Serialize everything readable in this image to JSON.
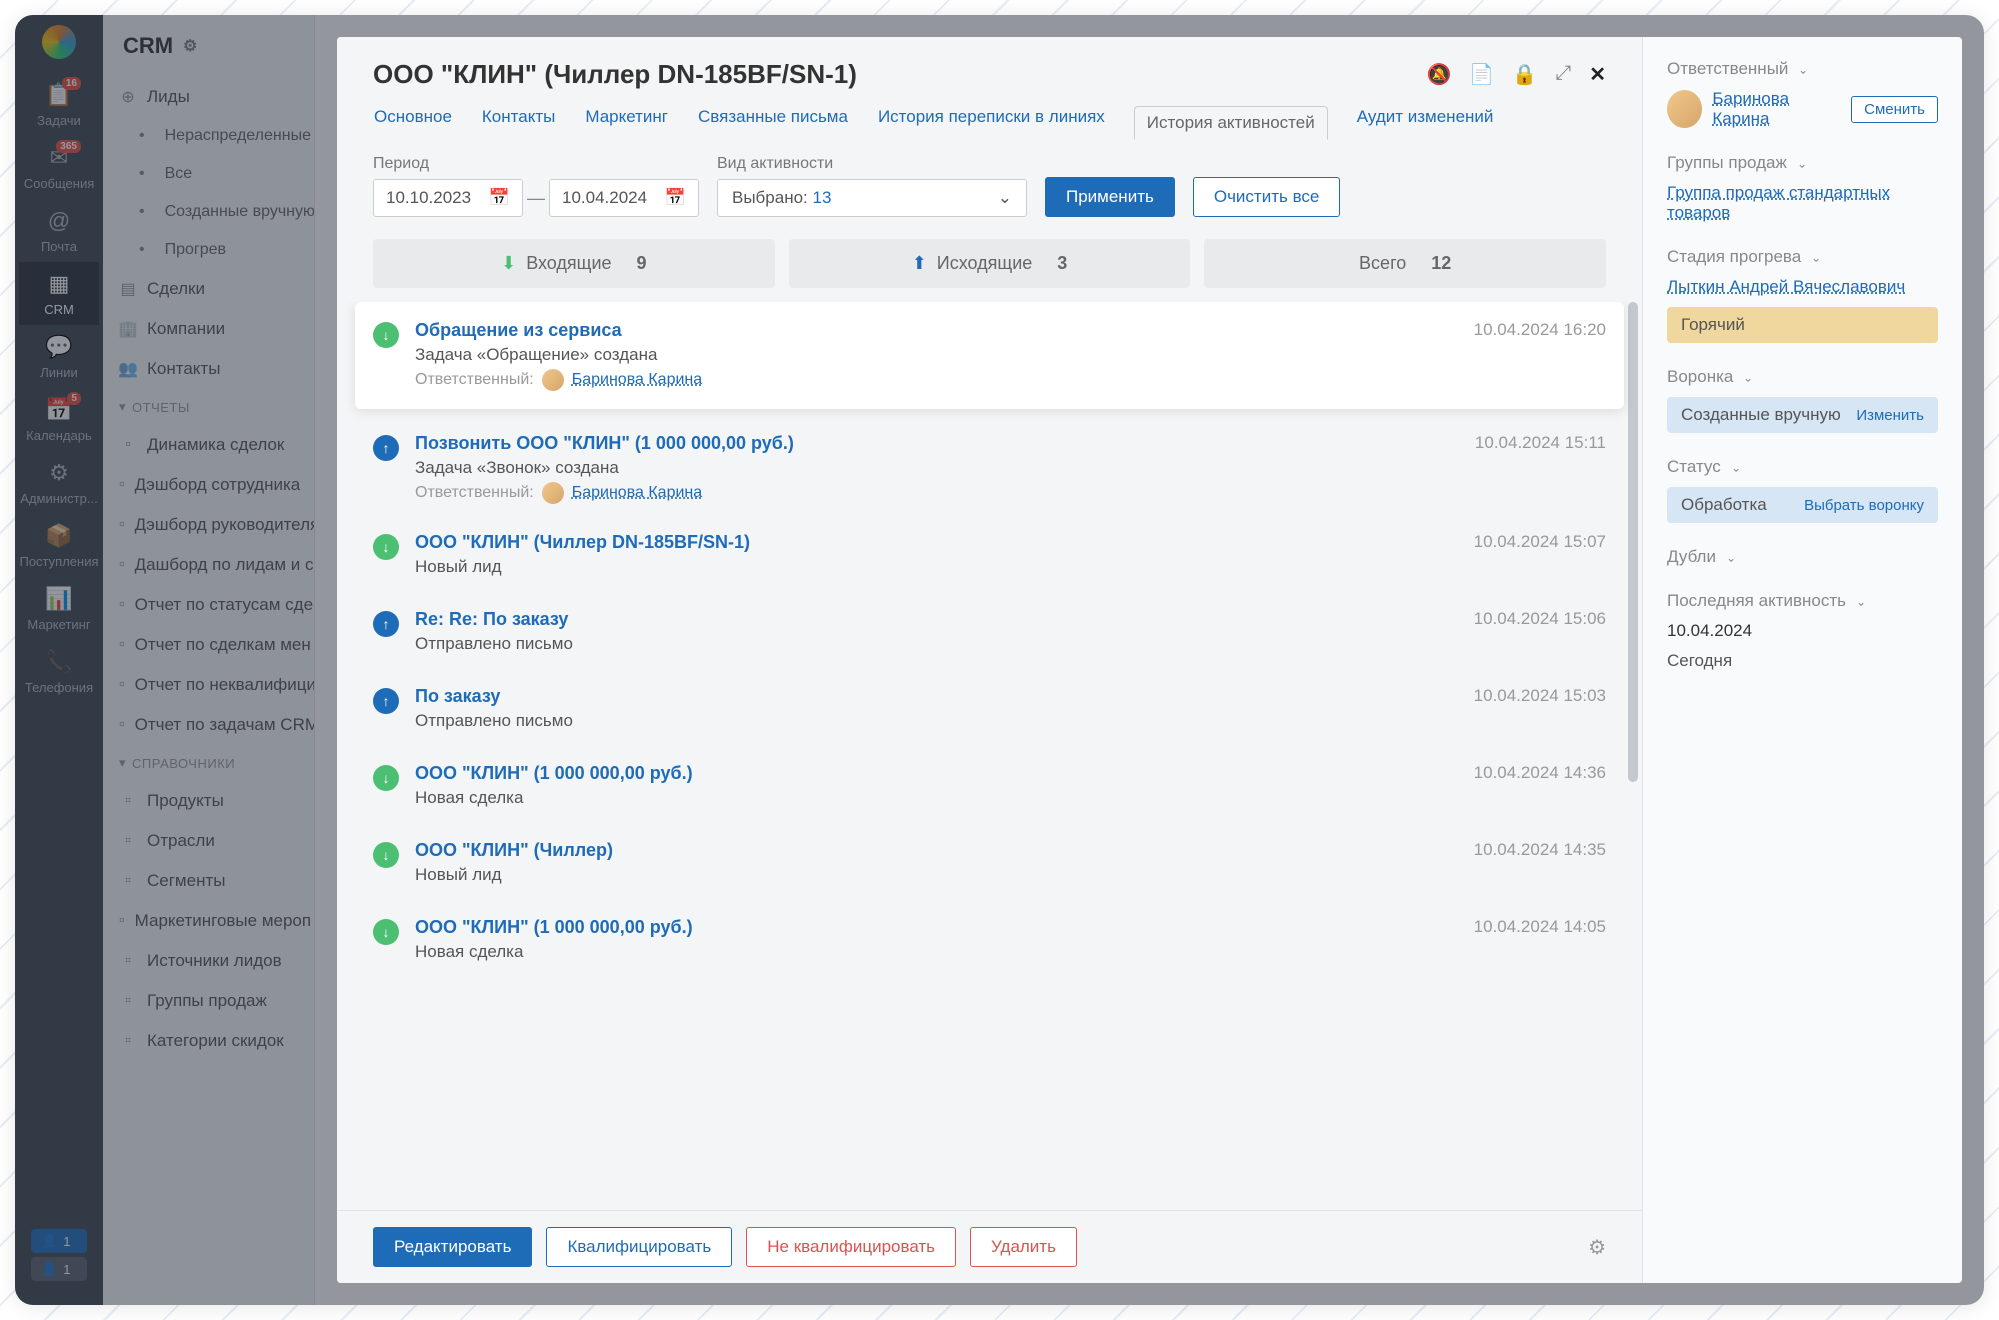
{
  "app": {
    "name": "CRM"
  },
  "nav": {
    "items": [
      {
        "label": "Задачи",
        "icon": "📋",
        "badge": "16"
      },
      {
        "label": "Сообщения",
        "icon": "✉",
        "badge": "365"
      },
      {
        "label": "Почта",
        "icon": "@"
      },
      {
        "label": "CRM",
        "icon": "▦",
        "active": true
      },
      {
        "label": "Линии",
        "icon": "💬"
      },
      {
        "label": "Календарь",
        "icon": "📅",
        "badge": "5"
      },
      {
        "label": "Администр...",
        "icon": "⚙"
      },
      {
        "label": "Поступления",
        "icon": "📦"
      },
      {
        "label": "Маркетинг",
        "icon": "📊"
      },
      {
        "label": "Телефония",
        "icon": "📞"
      }
    ],
    "bottom1": "1",
    "bottom2": "1"
  },
  "sidebar": {
    "leads": {
      "label": "Лиды",
      "items": [
        "Нераспределенные",
        "Все",
        "Созданные вручную",
        "Прогрев"
      ]
    },
    "deals": "Сделки",
    "companies": "Компании",
    "contacts": "Контакты",
    "reportsLabel": "ОТЧЕТЫ",
    "reports": [
      "Динамика сделок",
      "Дэшборд сотрудника",
      "Дэшборд руководителя",
      "Дашборд по лидам и с",
      "Отчет по статусам сде",
      "Отчет по сделкам мен",
      "Отчет по неквалифици",
      "Отчет по задачам CRM"
    ],
    "dictsLabel": "СПРАВОЧНИКИ",
    "dicts": [
      "Продукты",
      "Отрасли",
      "Сегменты",
      "Маркетинговые мероп",
      "Источники лидов",
      "Группы продаж",
      "Категории скидок"
    ]
  },
  "modal": {
    "title": "ООО \"КЛИН\" (Чиллер DN-185BF/SN-1)",
    "tabs": [
      "Основное",
      "Контакты",
      "Маркетинг",
      "Связанные письма",
      "История переписки в линиях",
      "История активностей",
      "Аудит изменений"
    ],
    "activeTab": 5,
    "filters": {
      "periodLabel": "Период",
      "from": "10.10.2023",
      "to": "10.04.2024",
      "typeLabel": "Вид активности",
      "typeValue": "Выбрано:",
      "typeCount": "13",
      "apply": "Применить",
      "clear": "Очистить все"
    },
    "stats": {
      "inLabel": "Входящие",
      "inCount": "9",
      "outLabel": "Исходящие",
      "outCount": "3",
      "totalLabel": "Всего",
      "totalCount": "12"
    },
    "timeline": [
      {
        "color": "green",
        "title": "Обращение из сервиса",
        "sub": "Задача «Обращение» создана",
        "respLabel": "Ответственный:",
        "resp": "Баринова Карина",
        "time": "10.04.2024 16:20",
        "hl": true
      },
      {
        "color": "blue",
        "title": "Позвонить ООО \"КЛИН\" (1 000 000,00 руб.)",
        "sub": "Задача «Звонок» создана",
        "respLabel": "Ответственный:",
        "resp": "Баринова Карина",
        "time": "10.04.2024 15:11"
      },
      {
        "color": "green",
        "title": "ООО \"КЛИН\" (Чиллер DN-185BF/SN-1)",
        "sub": "Новый лид",
        "time": "10.04.2024 15:07"
      },
      {
        "color": "blue",
        "title": "Re: Re: По заказу",
        "sub": "Отправлено письмо",
        "time": "10.04.2024 15:06"
      },
      {
        "color": "blue",
        "title": "По заказу",
        "sub": "Отправлено письмо",
        "time": "10.04.2024 15:03"
      },
      {
        "color": "green",
        "title": "ООО \"КЛИН\" (1 000 000,00 руб.)",
        "sub": "Новая сделка",
        "time": "10.04.2024 14:36"
      },
      {
        "color": "green",
        "title": "ООО \"КЛИН\" (Чиллер)",
        "sub": "Новый лид",
        "time": "10.04.2024 14:35"
      },
      {
        "color": "green",
        "title": "ООО \"КЛИН\" (1 000 000,00 руб.)",
        "sub": "Новая сделка",
        "time": "10.04.2024 14:05"
      }
    ],
    "footer": {
      "edit": "Редактировать",
      "qualify": "Квалифицировать",
      "disqualify": "Не квалифицировать",
      "delete": "Удалить"
    }
  },
  "panel": {
    "respTitle": "Ответственный",
    "respName": "Баринова Карина",
    "change": "Сменить",
    "groupsTitle": "Группы продаж",
    "groupsLink": "Группа продаж стандартных товаров",
    "stageTitle": "Стадия прогрева",
    "stagePerson": "Лыткин Андрей Вячеславович",
    "stageChip": "Горячий",
    "funnelTitle": "Воронка",
    "funnelChip": "Созданные вручную",
    "funnelAction": "Изменить",
    "statusTitle": "Статус",
    "statusChip": "Обработка",
    "statusAction": "Выбрать воронку",
    "dupTitle": "Дубли",
    "lastTitle": "Последняя активность",
    "lastDate": "10.04.2024",
    "lastWord": "Сегодня"
  }
}
